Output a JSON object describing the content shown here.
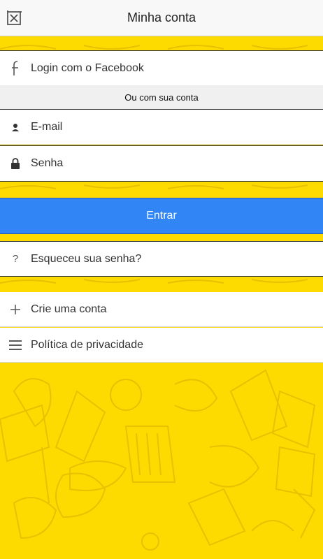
{
  "header": {
    "title": "Minha conta",
    "close_icon": "close-window-icon"
  },
  "facebook": {
    "icon": "facebook-icon",
    "label": "Login com o Facebook"
  },
  "divider_text": "Ou com sua conta",
  "form": {
    "email_icon": "user-icon",
    "email_placeholder": "E-mail",
    "password_icon": "lock-icon",
    "password_placeholder": "Senha",
    "submit_label": "Entrar"
  },
  "forgot": {
    "icon": "question-icon",
    "label": "Esqueceu sua senha?"
  },
  "menu": {
    "create_icon": "plus-icon",
    "create_label": "Crie uma conta",
    "privacy_icon": "menu-lines-icon",
    "privacy_label": "Política de privacidade"
  },
  "colors": {
    "background_yellow": "#fddb00",
    "button_blue": "#3285f5",
    "doodle_stroke": "#e8c400"
  }
}
